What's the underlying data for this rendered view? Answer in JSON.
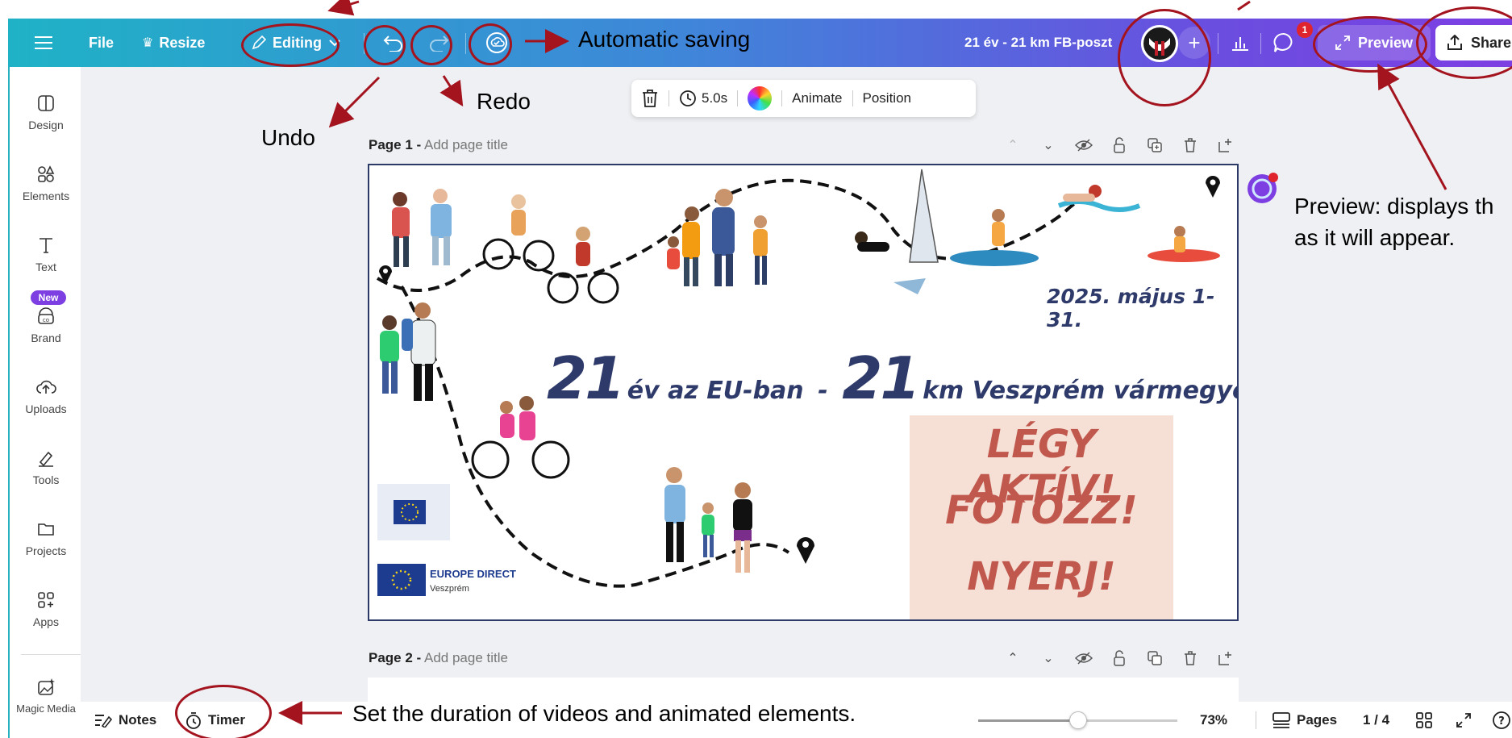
{
  "topbar": {
    "file_label": "File",
    "resize_label": "Resize",
    "editing_label": "Editing",
    "doc_title": "21 év - 21 km FB-poszt",
    "comment_count": "1",
    "preview_label": "Preview",
    "share_label": "Share"
  },
  "sidebar": {
    "items": [
      {
        "label": "Design",
        "icon": "design-icon"
      },
      {
        "label": "Elements",
        "icon": "elements-icon"
      },
      {
        "label": "Text",
        "icon": "text-icon"
      },
      {
        "label": "Brand",
        "icon": "brand-icon"
      },
      {
        "label": "Uploads",
        "icon": "uploads-icon"
      },
      {
        "label": "Tools",
        "icon": "tools-icon"
      },
      {
        "label": "Projects",
        "icon": "folder-icon"
      },
      {
        "label": "Apps",
        "icon": "apps-icon"
      },
      {
        "label": "Magic Media",
        "icon": "magic-media-icon"
      }
    ],
    "new_badge": "New"
  },
  "floatbar": {
    "duration": "5.0s",
    "animate_label": "Animate",
    "position_label": "Position"
  },
  "pages": [
    {
      "label": "Page 1 -",
      "title_placeholder": "Add page title"
    },
    {
      "label": "Page 2 -",
      "title_placeholder": "Add page title"
    }
  ],
  "design": {
    "date": "2025. május 1-31.",
    "num1": "21",
    "phrase1": "év az EU-ban",
    "dash": "-",
    "num2": "21",
    "phrase2": "km Veszprém vármegyében",
    "cta1": "LÉGY AKTÍV!",
    "cta2": "FOTÓZZ!",
    "cta3": "NYERJ!",
    "europe_direct": "EUROPE DIRECT",
    "europe_direct_city": "Veszprém"
  },
  "annotations": {
    "automatic_saving": "Automatic saving",
    "redo": "Redo",
    "undo": "Undo",
    "preview_note_line1": "Preview: displays th",
    "preview_note_line2": "as it will appear.",
    "timer_note": "Set the duration of videos and animated elements."
  },
  "bottombar": {
    "notes_label": "Notes",
    "timer_label": "Timer",
    "zoom_value": 0.5,
    "zoom_label": "73%",
    "pages_label": "Pages",
    "page_count": "1 / 4"
  },
  "colors": {
    "annotation": "#a3141f",
    "brand_gradient_start": "#1fb2c6",
    "brand_gradient_end": "#7d3fe2",
    "design_navy": "#2e3a6a",
    "cta_red": "#c0584e"
  }
}
